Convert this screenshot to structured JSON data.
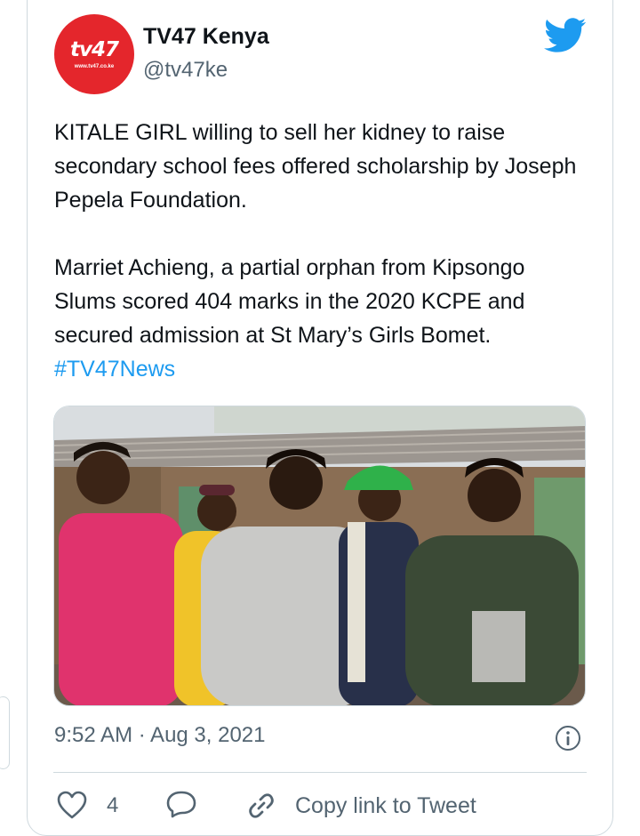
{
  "author": {
    "name": "TV47 Kenya",
    "handle": "@tv47ke",
    "avatar_logo_text": "tv47",
    "avatar_logo_url": "www.tv47.co.ke"
  },
  "tweet": {
    "paragraph1": "KITALE GIRL willing to sell her kidney to raise secondary school fees offered scholarship by Joseph Pepela Foundation.",
    "paragraph2": "Marriet Achieng, a partial orphan from Kipsongo Slums scored 404 marks in the 2020 KCPE and secured admission at St Mary’s Girls Bomet.",
    "hashtag": "#TV47News"
  },
  "timestamp": "9:52 AM · Aug 3, 2021",
  "actions": {
    "like_count": "4",
    "copy_link_label": "Copy link to Tweet"
  },
  "icons": {
    "platform": "twitter-bird-icon",
    "info": "info-icon",
    "like": "heart-icon",
    "reply": "reply-icon",
    "link": "link-icon"
  },
  "colors": {
    "brand_blue": "#1d9bf0",
    "avatar_red": "#e4262c",
    "secondary_text": "#536471",
    "border": "#cfd9de"
  }
}
